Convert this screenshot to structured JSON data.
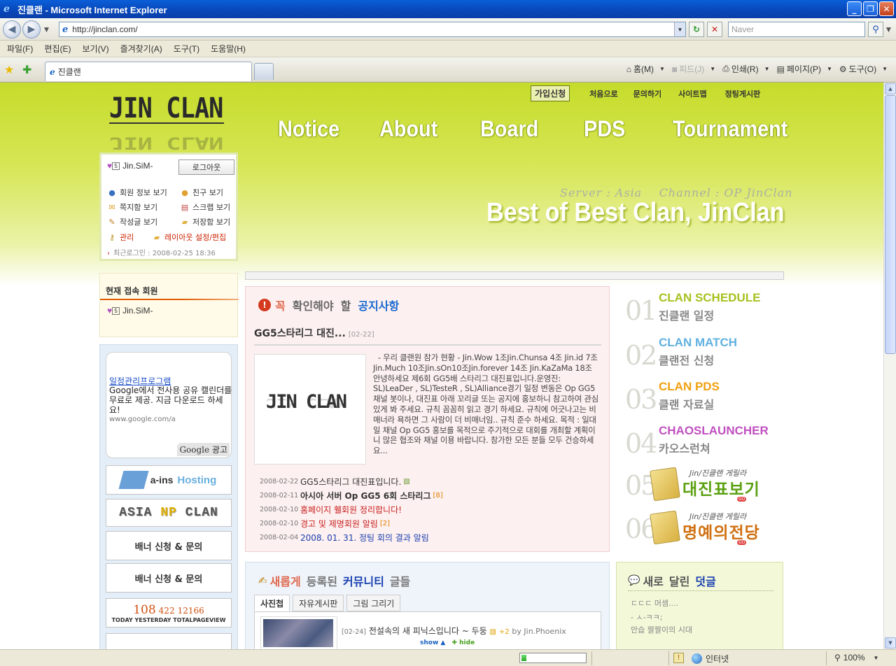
{
  "window": {
    "title": "진클랜 - Microsoft Internet Explorer",
    "minimize": "_",
    "maximize": "❐",
    "close": "✕"
  },
  "address": {
    "url": "http://jinclan.com/",
    "search_placeholder": "Naver"
  },
  "menubar": [
    "파일(F)",
    "편집(E)",
    "보기(V)",
    "즐겨찾기(A)",
    "도구(T)",
    "도움말(H)"
  ],
  "tab": {
    "title": "진클랜"
  },
  "commandbar": {
    "home": "홈(M)",
    "feeds": "피드(J)",
    "print": "인쇄(R)",
    "page": "페이지(P)",
    "tools": "도구(O)"
  },
  "site": {
    "logo": "JIN CLAN",
    "top_links": {
      "join": "가입신청",
      "home": "처음으로",
      "inquiry": "문의하기",
      "sitemap": "사이트맵",
      "regular_board": "정팅게시판"
    },
    "main_menu": [
      "Notice",
      "About",
      "Board",
      "PDS",
      "Tournament"
    ],
    "server_info": "Server : Asia    Channel : OP JinClan",
    "slogan": "Best of Best Clan, JinClan"
  },
  "login": {
    "level": "5",
    "username": "Jin.SiM-",
    "logout": "로그아웃",
    "menu": {
      "member_info": "회원 정보 보기",
      "friends": "친구 보기",
      "memos": "쪽지함 보기",
      "scraps": "스크랩 보기",
      "posts": "작성글 보기",
      "storage": "저장함 보기",
      "admin": "관리",
      "layout_setting": "레이아웃 설정",
      "edit": "/편집"
    },
    "last_login": "최근로그인 : 2008-02-25 18:36"
  },
  "online": {
    "title": "현재 접속 회원",
    "users": [
      "Jin.SiM-"
    ]
  },
  "ad": {
    "title": "일정관리프로그램",
    "desc": "Google에서 전사용 공유 캘린더를 무료로 제공. 지금 다운로드 하세요!",
    "url": "www.google.com/a",
    "badge": "Google 광고"
  },
  "banners": {
    "ains_tagline": "a-ins",
    "ains_hosting": "Hosting",
    "asia_left": "ASIA",
    "asia_np": "NP",
    "asia_right": "CLAN",
    "request1": "배너 신청 & 문의",
    "request2": "배너 신청 & 문의"
  },
  "counter": {
    "today": "108",
    "yesterday": "422",
    "total": "12166",
    "label": "TODAY YESTERDAY TOTALPAGEVIEW"
  },
  "notice": {
    "head": [
      "꼭",
      "확인해야",
      "할",
      "공지사항"
    ],
    "featured_title": "GG5스타리그 대진...",
    "featured_date": "[02-22]",
    "thumb_logo": "JIN CLAN",
    "body": "  - 우리 클랜원 참가 현황 - Jin.Wow 1조Jin.Chunsa 4조 Jin.id 7조Jin.Much 10조Jin.sOn10조Jin.forever 14조 Jin.KaZaMa 18조 안녕하세요 제6회 GG5배 스타리그 대진표입니다.운영진: SL)LeaDer , SL)TesteR , SL)Alliance경기 일정 변동은 Op GG5 채널 봇이나, 대진표 아래 꼬리글 또는 공지에 홍보하니 참고하여 관심있게 봐 주세요. 규칙 꼼꼼히 읽고 경기 하세요. 규칙에 어긋나고는 비매너라 욕하면 그 사람이 더 비매너임.. 규칙 준수 하세요. 목적 : 일대일 채널 Op GG5 홍보를 목적으로 주기적으로 대회를 개최할 계획이니 많은 협조와 채널 이용 바랍니다. 참가한 모든 분들 모두 건승하세요...",
    "list": [
      {
        "date": "2008-02-22",
        "title": "GG5스타리그 대진표입니다.",
        "count": "▧",
        "style": ""
      },
      {
        "date": "2008-02-11",
        "title": "아시아 서버 Op GG5 6회 스타리그",
        "count": "[8]",
        "style": "bold"
      },
      {
        "date": "2008-02-10",
        "title": "홈페이지 휄회원 정리합니다!",
        "count": "",
        "style": "red"
      },
      {
        "date": "2008-02-10",
        "title": "경고 및 제명회원 알림",
        "count": "[2]",
        "style": "red"
      },
      {
        "date": "2008-02-04",
        "title": "2008. 01. 31. 정팅 회의 결과 알림",
        "count": "",
        "style": "blue"
      }
    ]
  },
  "right_menu": [
    {
      "num": "01",
      "en": "CLAN SCHEDULE",
      "ko": "진클랜 일정",
      "color": "#a8c020"
    },
    {
      "num": "02",
      "en": "CLAN MATCH",
      "ko": "클랜전 신청",
      "color": "#60b0e0"
    },
    {
      "num": "03",
      "en": "CLAN PDS",
      "ko": "클랜 자료실",
      "color": "#f0a010"
    },
    {
      "num": "04",
      "en": "CHAOSLAUNCHER",
      "ko": "카오스런쳐",
      "color": "#c050c0"
    }
  ],
  "right_images": [
    {
      "num": "05",
      "sub": "Jin/진클랜 게릴라",
      "big": "대진표보기",
      "color": "#5aa010",
      "go": "GO"
    },
    {
      "num": "06",
      "sub": "Jin/진클랜 게릴라",
      "big": "명예의전당",
      "color": "#d07010",
      "go": "GO"
    }
  ],
  "community": {
    "head": [
      "새롭게",
      "등록된",
      "커뮤니티",
      "글들"
    ],
    "tabs": [
      "사진첩",
      "자유게시판",
      "그림 그리기"
    ],
    "post": {
      "date": "[02-24]",
      "title": "전설속의 새 피닉스입니다 ~ 두둥",
      "comments": "2",
      "by": "by Jin.Phoenix"
    }
  },
  "comments": {
    "head": [
      "새로",
      "달린",
      "덧글"
    ],
    "items": [
      "ㄷㄷㄷ 머셈....",
      "- ㅅ-ㅋㅋ;",
      "안습 짤짤이의 시대"
    ]
  },
  "showhide": {
    "show": "show ▲",
    "hide": "✚ hide"
  },
  "status": {
    "zone": "인터넷",
    "zoom": "100%",
    "progress": 0.08
  }
}
